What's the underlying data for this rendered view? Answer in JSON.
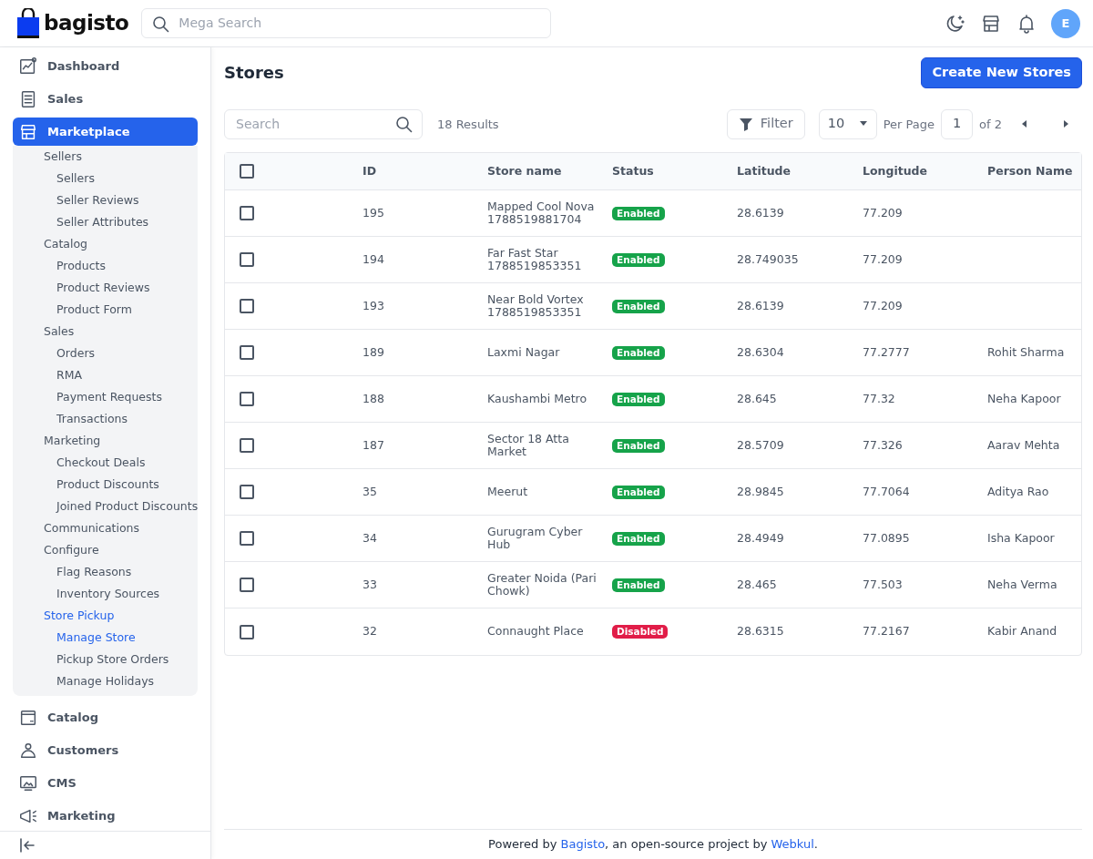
{
  "header": {
    "logo": "bagisto",
    "search_placeholder": "Mega Search",
    "avatar": "E"
  },
  "sidebar": {
    "items": [
      {
        "label": "Dashboard",
        "selected": false
      },
      {
        "label": "Sales",
        "selected": false
      },
      {
        "label": "Marketplace",
        "selected": true,
        "expanded": true,
        "children": [
          {
            "label": "Sellers",
            "selected": false,
            "children": [
              {
                "label": "Sellers",
                "selected": false
              },
              {
                "label": "Seller Reviews",
                "selected": false
              },
              {
                "label": "Seller Attributes",
                "selected": false
              }
            ]
          },
          {
            "label": "Catalog",
            "selected": false,
            "children": [
              {
                "label": "Products",
                "selected": false
              },
              {
                "label": "Product Reviews",
                "selected": false
              },
              {
                "label": "Product Form",
                "selected": false
              }
            ]
          },
          {
            "label": "Sales",
            "selected": false,
            "children": [
              {
                "label": "Orders",
                "selected": false
              },
              {
                "label": "RMA",
                "selected": false
              },
              {
                "label": "Payment Requests",
                "selected": false
              },
              {
                "label": "Transactions",
                "selected": false
              }
            ]
          },
          {
            "label": "Marketing",
            "selected": false,
            "children": [
              {
                "label": "Checkout Deals",
                "selected": false
              },
              {
                "label": "Product Discounts",
                "selected": false
              },
              {
                "label": "Joined Product Discounts",
                "selected": false
              }
            ]
          },
          {
            "label": "Communications",
            "selected": false
          },
          {
            "label": "Configure",
            "selected": false,
            "children": [
              {
                "label": "Flag Reasons",
                "selected": false
              },
              {
                "label": "Inventory Sources",
                "selected": false
              }
            ]
          },
          {
            "label": "Store Pickup",
            "selected": true,
            "children": [
              {
                "label": "Manage Store",
                "selected": true
              },
              {
                "label": "Pickup Store Orders",
                "selected": false
              },
              {
                "label": "Manage Holidays",
                "selected": false
              }
            ]
          }
        ]
      },
      {
        "label": "Catalog",
        "selected": false
      },
      {
        "label": "Customers",
        "selected": false
      },
      {
        "label": "CMS",
        "selected": false
      },
      {
        "label": "Marketing",
        "selected": false
      }
    ]
  },
  "page": {
    "title": "Stores",
    "create_button": "Create New Stores"
  },
  "toolbar": {
    "search_placeholder": "Search",
    "results": "18 Results",
    "filter": "Filter",
    "per_page_value": "10",
    "per_page_label": "Per Page",
    "page": "1",
    "page_total": "of 2"
  },
  "table": {
    "columns": [
      "ID",
      "Store name",
      "Status",
      "Latitude",
      "Longitude",
      "Person Name"
    ],
    "header_checked": false,
    "rows": [
      {
        "checked": false,
        "id": "195",
        "store_name": "Mapped Cool Nova 1788519881704",
        "status": {
          "label": "Enabled",
          "kind": "enabled"
        },
        "latitude": "28.6139",
        "longitude": "77.209"
      },
      {
        "checked": false,
        "id": "194",
        "store_name": "Far Fast Star 1788519853351",
        "status": {
          "label": "Enabled",
          "kind": "enabled"
        },
        "latitude": "28.749035",
        "longitude": "77.209"
      },
      {
        "checked": false,
        "id": "193",
        "store_name": "Near Bold Vortex 1788519853351",
        "status": {
          "label": "Enabled",
          "kind": "enabled"
        },
        "latitude": "28.6139",
        "longitude": "77.209"
      },
      {
        "checked": false,
        "id": "189",
        "store_name": "Laxmi Nagar",
        "status": {
          "label": "Enabled",
          "kind": "enabled"
        },
        "latitude": "28.6304",
        "longitude": "77.2777",
        "person_name": "Rohit Sharma"
      },
      {
        "checked": false,
        "id": "188",
        "store_name": "Kaushambi Metro",
        "status": {
          "label": "Enabled",
          "kind": "enabled"
        },
        "latitude": "28.645",
        "longitude": "77.32",
        "person_name": "Neha Kapoor"
      },
      {
        "checked": false,
        "id": "187",
        "store_name": "Sector 18 Atta Market",
        "status": {
          "label": "Enabled",
          "kind": "enabled"
        },
        "latitude": "28.5709",
        "longitude": "77.326",
        "person_name": "Aarav Mehta"
      },
      {
        "checked": false,
        "id": "35",
        "store_name": "Meerut",
        "status": {
          "label": "Enabled",
          "kind": "enabled"
        },
        "latitude": "28.9845",
        "longitude": "77.7064",
        "person_name": "Aditya Rao"
      },
      {
        "checked": false,
        "id": "34",
        "store_name": "Gurugram Cyber Hub",
        "status": {
          "label": "Enabled",
          "kind": "enabled"
        },
        "latitude": "28.4949",
        "longitude": "77.0895",
        "person_name": "Isha Kapoor"
      },
      {
        "checked": false,
        "id": "33",
        "store_name": "Greater Noida (Pari Chowk)",
        "status": {
          "label": "Enabled",
          "kind": "enabled"
        },
        "latitude": "28.465",
        "longitude": "77.503",
        "person_name": "Neha Verma"
      },
      {
        "checked": false,
        "id": "32",
        "store_name": "Connaught Place",
        "status": {
          "label": "Disabled",
          "kind": "disabled"
        },
        "latitude": "28.6315",
        "longitude": "77.2167",
        "person_name": "Kabir Anand"
      }
    ]
  },
  "footer": {
    "prefix": "Powered by ",
    "link_1": "Bagisto",
    "middle": ", an open-source project by ",
    "link_2": "Webkul",
    "suffix": "."
  }
}
